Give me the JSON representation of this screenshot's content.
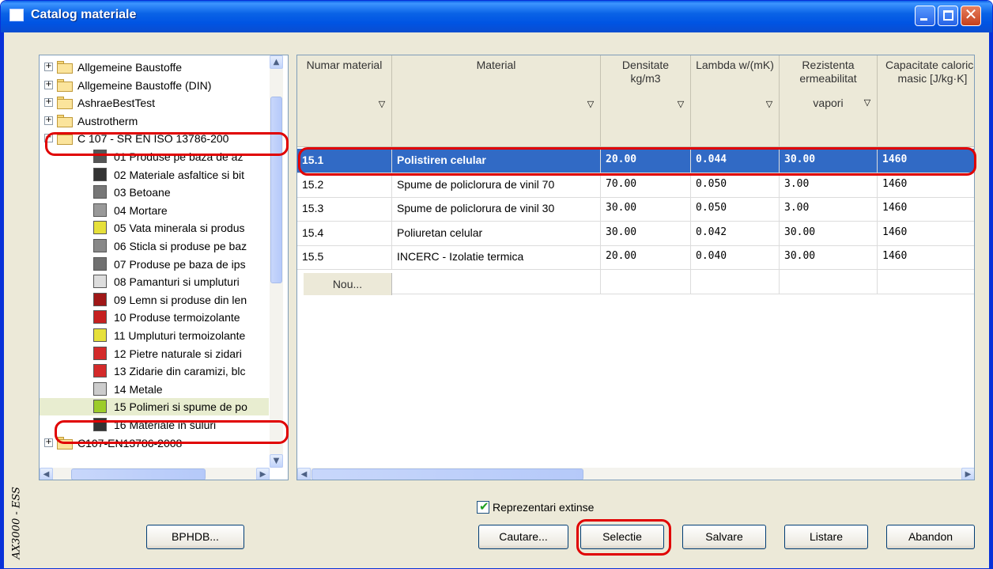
{
  "window": {
    "title": "Catalog materiale",
    "side_label": "AX3000 - ESS"
  },
  "tree": {
    "items": [
      {
        "kind": "parent",
        "sign": "+",
        "label": "Allgemeine Baustoffe"
      },
      {
        "kind": "parent",
        "sign": "+",
        "label": "Allgemeine Baustoffe (DIN)"
      },
      {
        "kind": "parent",
        "sign": "+",
        "label": "AshraeBestTest"
      },
      {
        "kind": "parent",
        "sign": "+",
        "label": "Austrotherm"
      },
      {
        "kind": "parent",
        "sign": "−",
        "label": "C 107 - SR EN ISO 13786-200"
      },
      {
        "kind": "child",
        "label": "01 Produse pe baza de az",
        "swatch": "#555555"
      },
      {
        "kind": "child",
        "label": "02 Materiale asfaltice si bit",
        "swatch": "#333333"
      },
      {
        "kind": "child",
        "label": "03 Betoane",
        "swatch": "#777777"
      },
      {
        "kind": "child",
        "label": "04 Mortare",
        "swatch": "#999999"
      },
      {
        "kind": "child",
        "label": "05 Vata minerala si produs",
        "swatch": "#e6e03a"
      },
      {
        "kind": "child",
        "label": "06 Sticla si produse pe baz",
        "swatch": "#888888"
      },
      {
        "kind": "child",
        "label": "07 Produse pe baza de ips",
        "swatch": "#707070"
      },
      {
        "kind": "child",
        "label": "08 Pamanturi si umpluturi",
        "swatch": "#dddddd"
      },
      {
        "kind": "child",
        "label": "09 Lemn si produse din len",
        "swatch": "#a01818"
      },
      {
        "kind": "child",
        "label": "10 Produse termoizolante",
        "swatch": "#c62020"
      },
      {
        "kind": "child",
        "label": "11 Umpluturi termoizolante",
        "swatch": "#e6e03a"
      },
      {
        "kind": "child",
        "label": "12 Pietre naturale si zidari",
        "swatch": "#d42a2a"
      },
      {
        "kind": "child",
        "label": "13 Zidarie din caramizi, blc",
        "swatch": "#d42a2a"
      },
      {
        "kind": "child",
        "label": "14 Metale",
        "swatch": "#cccccc"
      },
      {
        "kind": "child",
        "label": "15 Polimeri si spume de po",
        "swatch": "#9ccc2a"
      },
      {
        "kind": "child",
        "label": "16 Materiale in suluri",
        "swatch": "#333333"
      },
      {
        "kind": "parent",
        "sign": "+",
        "label": "C107-EN13786-2008"
      }
    ]
  },
  "grid": {
    "columns": [
      {
        "label": "Numar material"
      },
      {
        "label": "Material"
      },
      {
        "label": "Densitate kg/m3"
      },
      {
        "label": "Lambda w/(mK)"
      },
      {
        "label": "Rezistenta ermeabilitat",
        "extra": "vapori"
      },
      {
        "label": "Capacitate calorica masic [J/kg·K]"
      }
    ],
    "rows": [
      [
        "15.1",
        "Polistiren celular",
        "20.00",
        "0.044",
        "30.00",
        "1460"
      ],
      [
        "15.2",
        "Spume de policlorura de vinil 70",
        "70.00",
        "0.050",
        "3.00",
        "1460"
      ],
      [
        "15.3",
        "Spume de policlorura de vinil 30",
        "30.00",
        "0.050",
        "3.00",
        "1460"
      ],
      [
        "15.4",
        "Poliuretan celular",
        "30.00",
        "0.042",
        "30.00",
        "1460"
      ],
      [
        "15.5",
        "INCERC - Izolatie termica",
        "20.00",
        "0.040",
        "30.00",
        "1460"
      ]
    ],
    "new_label": "Nou..."
  },
  "checkbox": {
    "label": "Reprezentari extinse",
    "checked": true
  },
  "buttons": {
    "bphdb": "BPHDB...",
    "cautare": "Cautare...",
    "selectie": "Selectie",
    "salvare": "Salvare",
    "listare": "Listare",
    "abandon": "Abandon"
  },
  "colors": {
    "selection": "#316ac5",
    "highlight_ring": "#e00000",
    "titlebar": "#0054e3"
  }
}
